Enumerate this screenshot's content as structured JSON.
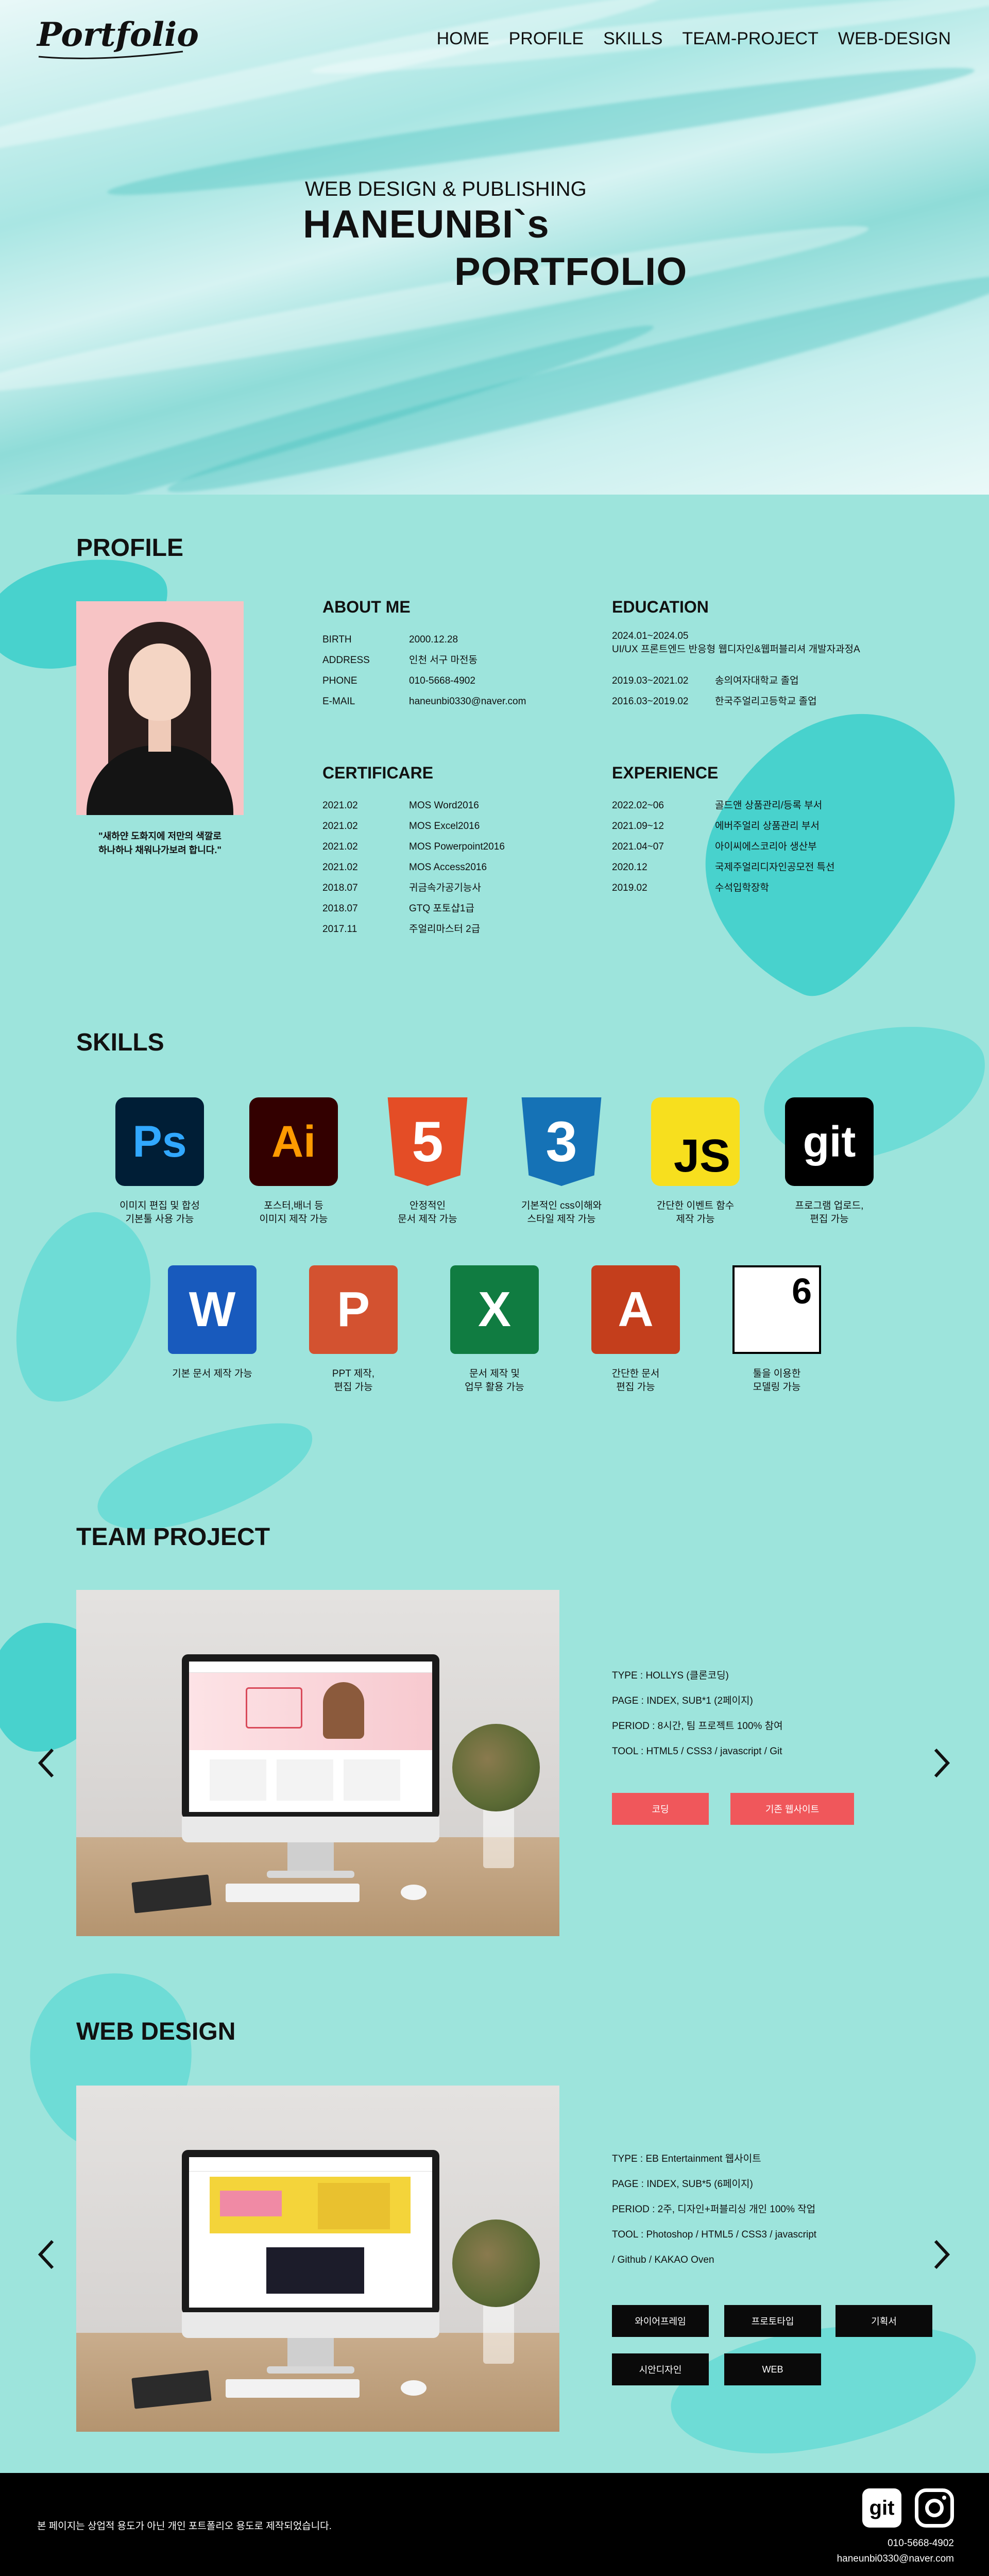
{
  "header": {
    "logo": "Portfolio",
    "nav": [
      "HOME",
      "PROFILE",
      "SKILLS",
      "TEAM-PROJECT",
      "WEB-DESIGN"
    ]
  },
  "hero": {
    "subtitle": "WEB DESIGN & PUBLISHING",
    "title_line1": "HANEUNBI`s",
    "title_line2": "PORTFOLIO"
  },
  "profile": {
    "title": "PROFILE",
    "quote_line1": "\"새하얀 도화지에 저만의 색깔로",
    "quote_line2": "하나하나 채워나가보려 합니다.\"",
    "about": {
      "title": "ABOUT ME",
      "rows": [
        {
          "k": "BIRTH",
          "v": "2000.12.28"
        },
        {
          "k": "ADDRESS",
          "v": "인천 서구 마전동"
        },
        {
          "k": "PHONE",
          "v": "010-5668-4902"
        },
        {
          "k": "E-MAIL",
          "v": "haneunbi0330@naver.com"
        }
      ]
    },
    "education": {
      "title": "EDUCATION",
      "top_date": "2024.01~2024.05",
      "top_desc": "UI/UX 프론트엔드 반응형 웹디자인&웹퍼블리셔 개발자과정A",
      "rows": [
        {
          "k": "2019.03~2021.02",
          "v": "송의여자대학교 졸업"
        },
        {
          "k": "2016.03~2019.02",
          "v": "한국주얼리고등학교 졸업"
        }
      ]
    },
    "certificate": {
      "title": "CERTIFICARE",
      "rows": [
        {
          "k": "2021.02",
          "v": "MOS Word2016"
        },
        {
          "k": "2021.02",
          "v": "MOS Excel2016"
        },
        {
          "k": "2021.02",
          "v": "MOS Powerpoint2016"
        },
        {
          "k": "2021.02",
          "v": "MOS Access2016"
        },
        {
          "k": "2018.07",
          "v": "귀금속가공기능사"
        },
        {
          "k": "2018.07",
          "v": "GTQ 포토샵1급"
        },
        {
          "k": "2017.11",
          "v": "주얼리마스터 2급"
        }
      ]
    },
    "experience": {
      "title": "EXPERIENCE",
      "rows": [
        {
          "k": "2022.02~06",
          "v": "골드앤 상품관리/등록 부서"
        },
        {
          "k": "2021.09~12",
          "v": "에버주얼리 상품관리 부서"
        },
        {
          "k": "2021.04~07",
          "v": "아이씨에스코리아 생산부"
        },
        {
          "k": "2020.12",
          "v": "국제주얼리디자인공모전 특선"
        },
        {
          "k": "2019.02",
          "v": "수석입학장학"
        }
      ]
    }
  },
  "skills": {
    "title": "SKILLS",
    "items": [
      {
        "icon": "photoshop-icon",
        "label": "Ps",
        "cap1": "이미지 편집 및 합성",
        "cap2": "기본툴 사용 가능",
        "bg": "#001e36",
        "fg": "#31a8ff"
      },
      {
        "icon": "illustrator-icon",
        "label": "Ai",
        "cap1": "포스터,배너 등",
        "cap2": "이미지 제작 가능",
        "bg": "#330000",
        "fg": "#ff9a00"
      },
      {
        "icon": "html5-icon",
        "label": "5",
        "cap1": "안정적인",
        "cap2": "문서 제작 가능",
        "bg": "#e44d26",
        "fg": "#ffffff"
      },
      {
        "icon": "css3-icon",
        "label": "3",
        "cap1": "기본적인 css이해와",
        "cap2": "스타일 제작 가능",
        "bg": "#1572b6",
        "fg": "#ffffff"
      },
      {
        "icon": "javascript-icon",
        "label": "JS",
        "cap1": "간단한 이벤트 함수",
        "cap2": "제작 가능",
        "bg": "#f7df1e",
        "fg": "#000000"
      },
      {
        "icon": "git-icon",
        "label": "git",
        "cap1": "프로그램 업로드,",
        "cap2": "편집 가능",
        "bg": "#000000",
        "fg": "#ffffff"
      },
      {
        "icon": "word-icon",
        "label": "W",
        "cap1": "기본 문서 제작 가능",
        "cap2": "",
        "bg": "#185abd",
        "fg": "#ffffff"
      },
      {
        "icon": "powerpoint-icon",
        "label": "P",
        "cap1": "PPT 제작,",
        "cap2": "편집 가능",
        "bg": "#d35230",
        "fg": "#ffffff"
      },
      {
        "icon": "excel-icon",
        "label": "X",
        "cap1": "문서 제작 및",
        "cap2": "업무 활용 가능",
        "bg": "#107c41",
        "fg": "#ffffff"
      },
      {
        "icon": "access-icon",
        "label": "A",
        "cap1": "간단한 문서",
        "cap2": "편집 가능",
        "bg": "#c43e1c",
        "fg": "#ffffff"
      },
      {
        "icon": "rhino-icon",
        "label": "6",
        "cap1": "툴을 이용한",
        "cap2": "모델링 가능",
        "bg": "#ffffff",
        "fg": "#000000"
      }
    ]
  },
  "team_project": {
    "title": "TEAM PROJECT",
    "info": [
      "TYPE : HOLLYS (클론코딩)",
      "PAGE : INDEX, SUB*1 (2페이지)",
      "PERIOD : 8시간, 팀 프로젝트 100% 참여",
      "TOOL : HTML5 / CSS3 / javascript / Git"
    ],
    "buttons": [
      "코딩",
      "기존 웹사이트"
    ]
  },
  "web_design": {
    "title": "WEB DESIGN",
    "info": [
      "TYPE : EB Entertainment 웹사이트",
      "PAGE : INDEX, SUB*5 (6페이지)",
      "PERIOD : 2주, 디자인+퍼블리싱 개인 100% 작업",
      "TOOL : Photoshop / HTML5 / CSS3 / javascript",
      "/ Github / KAKAO Oven"
    ],
    "buttons": [
      "와이어프레임",
      "프로토타입",
      "기획서",
      "시안디자인",
      "WEB"
    ]
  },
  "footer": {
    "note": "본 페이지는 상업적 용도가 아닌 개인 포트폴리오 용도로 제작되었습니다.",
    "git_label": "git",
    "phone": "010-5668-4902",
    "email": "haneunbi0330@naver.com"
  },
  "colors": {
    "background": "#9de4dc",
    "accent_red": "#f0575b",
    "footer": "#000000"
  }
}
